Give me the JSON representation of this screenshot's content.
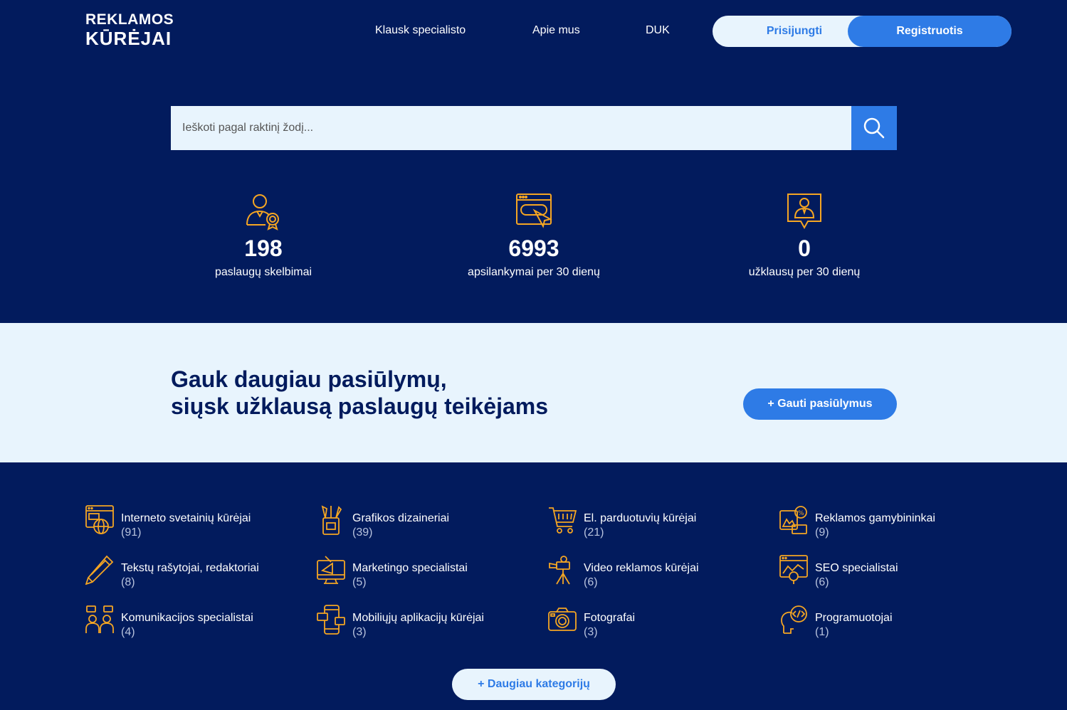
{
  "logo": {
    "line1": "REKLAMOS",
    "line2": "KŪRĖJAI"
  },
  "nav": {
    "ask": "Klausk specialisto",
    "about": "Apie mus",
    "faq": "DUK"
  },
  "auth": {
    "login": "Prisijungti",
    "register": "Registruotis"
  },
  "search": {
    "placeholder": "Ieškoti pagal raktinį žodį..."
  },
  "stats": [
    {
      "value": "198",
      "label": "paslaugų skelbimai",
      "icon": "certified-person-icon"
    },
    {
      "value": "6993",
      "label": "apsilankymai per 30 dienų",
      "icon": "browser-click-icon"
    },
    {
      "value": "0",
      "label": "užklausų per 30 dienų",
      "icon": "person-bubble-icon"
    }
  ],
  "cta_band": {
    "title_line1": "Gauk daugiau pasiūlymų,",
    "title_line2": "siųsk užklausą paslaugų teikėjams",
    "button": "+ Gauti pasiūlymus"
  },
  "categories": [
    {
      "name": "Interneto svetainių kūrėjai",
      "count": "(91)",
      "icon": "website-globe-icon"
    },
    {
      "name": "Grafikos dizaineriai",
      "count": "(39)",
      "icon": "pencil-cup-icon"
    },
    {
      "name": "El. parduotuvių kūrėjai",
      "count": "(21)",
      "icon": "shopping-cart-icon"
    },
    {
      "name": "Reklamos gamybininkai",
      "count": "(9)",
      "icon": "ad-production-icon"
    },
    {
      "name": "Tekstų rašytojai, redaktoriai",
      "count": "(8)",
      "icon": "pencil-icon"
    },
    {
      "name": "Marketingo specialistai",
      "count": "(5)",
      "icon": "megaphone-monitor-icon"
    },
    {
      "name": "Video reklamos kūrėjai",
      "count": "(6)",
      "icon": "video-camera-tripod-icon"
    },
    {
      "name": "SEO specialistai",
      "count": "(6)",
      "icon": "seo-browser-icon"
    },
    {
      "name": "Komunikacijos specialistai",
      "count": "(4)",
      "icon": "people-chat-icon"
    },
    {
      "name": "Mobiliųjų aplikacijų kūrėjai",
      "count": "(3)",
      "icon": "mobile-app-icon"
    },
    {
      "name": "Fotografai",
      "count": "(3)",
      "icon": "photo-camera-icon"
    },
    {
      "name": "Programuotojai",
      "count": "(1)",
      "icon": "code-head-icon"
    }
  ],
  "more_button": "+ Daugiau kategorijų",
  "colors": {
    "navy": "#021b5d",
    "blue": "#2e7be6",
    "light": "#e8f4fd",
    "icon_orange": "#f5a623"
  }
}
